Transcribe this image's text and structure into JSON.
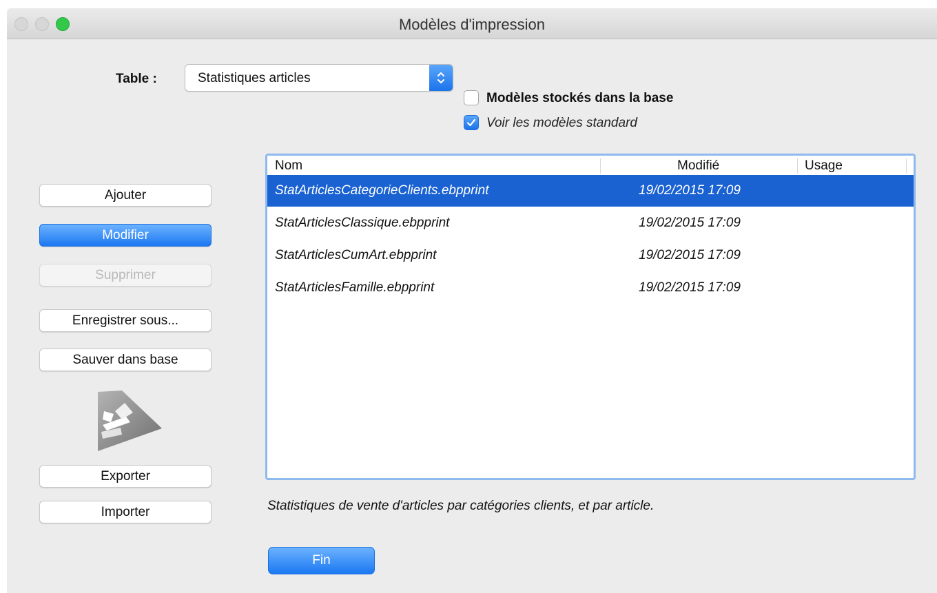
{
  "window": {
    "title": "Modèles d'impression"
  },
  "table": {
    "label": "Table :",
    "selected": "Statistiques articles"
  },
  "options": {
    "stored_in_db": {
      "label": "Modèles stockés dans la base",
      "checked": false
    },
    "show_standard": {
      "label": "Voir les modèles standard",
      "checked": true
    }
  },
  "buttons": {
    "add": "Ajouter",
    "edit": "Modifier",
    "delete": "Supprimer",
    "save_as": "Enregistrer sous...",
    "save_db": "Sauver dans base",
    "export": "Exporter",
    "import": "Importer",
    "done": "Fin"
  },
  "list": {
    "columns": {
      "name": "Nom",
      "modified": "Modifié",
      "usage": "Usage"
    },
    "rows": [
      {
        "name": "StatArticlesCategorieClients.ebpprint",
        "modified": "19/02/2015 17:09",
        "usage": "",
        "selected": true
      },
      {
        "name": "StatArticlesClassique.ebpprint",
        "modified": "19/02/2015 17:09",
        "usage": ""
      },
      {
        "name": "StatArticlesCumArt.ebpprint",
        "modified": "19/02/2015 17:09",
        "usage": ""
      },
      {
        "name": "StatArticlesFamille.ebpprint",
        "modified": "19/02/2015 17:09",
        "usage": ""
      }
    ]
  },
  "description": "Statistiques de vente d'articles par catégories clients, et par article.",
  "colors": {
    "accent": "#1a62d2",
    "button_blue": "#1b78f2"
  },
  "icons": {
    "logo": "ebp-logo-icon"
  }
}
